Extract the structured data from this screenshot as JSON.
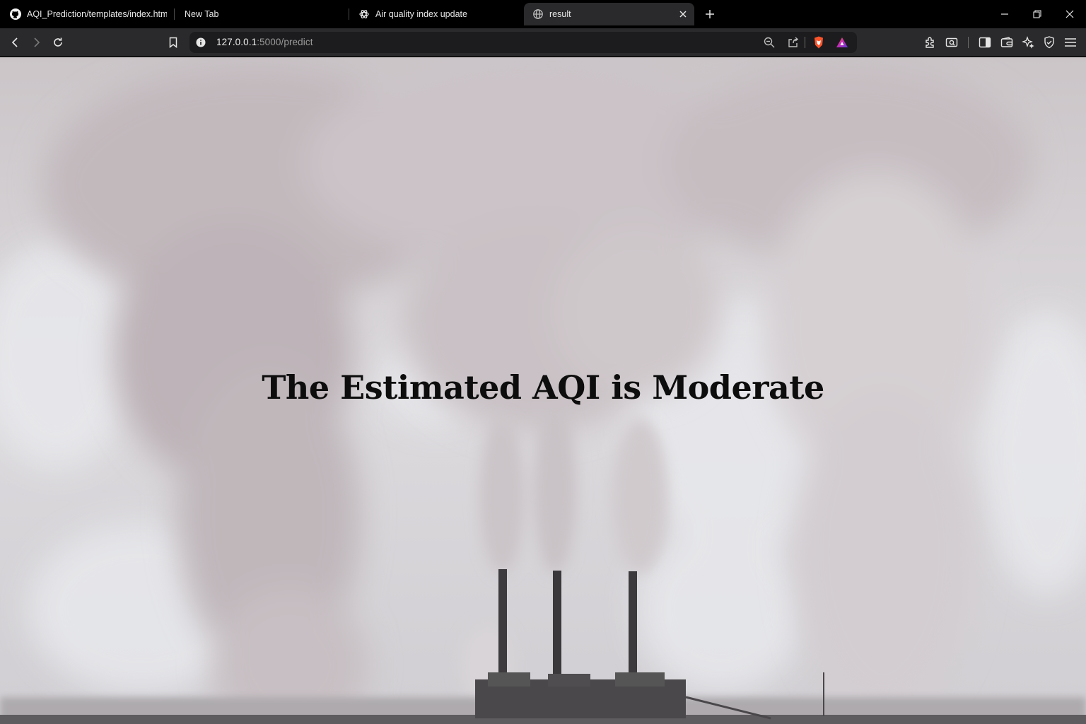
{
  "browser": {
    "tabs": [
      {
        "title": "AQI_Prediction/templates/index.html",
        "icon": "github-icon"
      },
      {
        "title": "New Tab",
        "icon": ""
      },
      {
        "title": "Air quality index update",
        "icon": "openai-icon"
      },
      {
        "title": "result",
        "icon": "globe-icon",
        "active": true
      }
    ],
    "address": {
      "host": "127.0.0.1",
      "path": ":5000/predict"
    }
  },
  "page": {
    "heading": "The Estimated AQI is Moderate",
    "background": "smokestacks-photo"
  },
  "colors": {
    "toolbar": "#2a2a2c",
    "tabstrip": "#000000",
    "heading": "#0d0d0d",
    "brave_orange": "#fb542b"
  }
}
